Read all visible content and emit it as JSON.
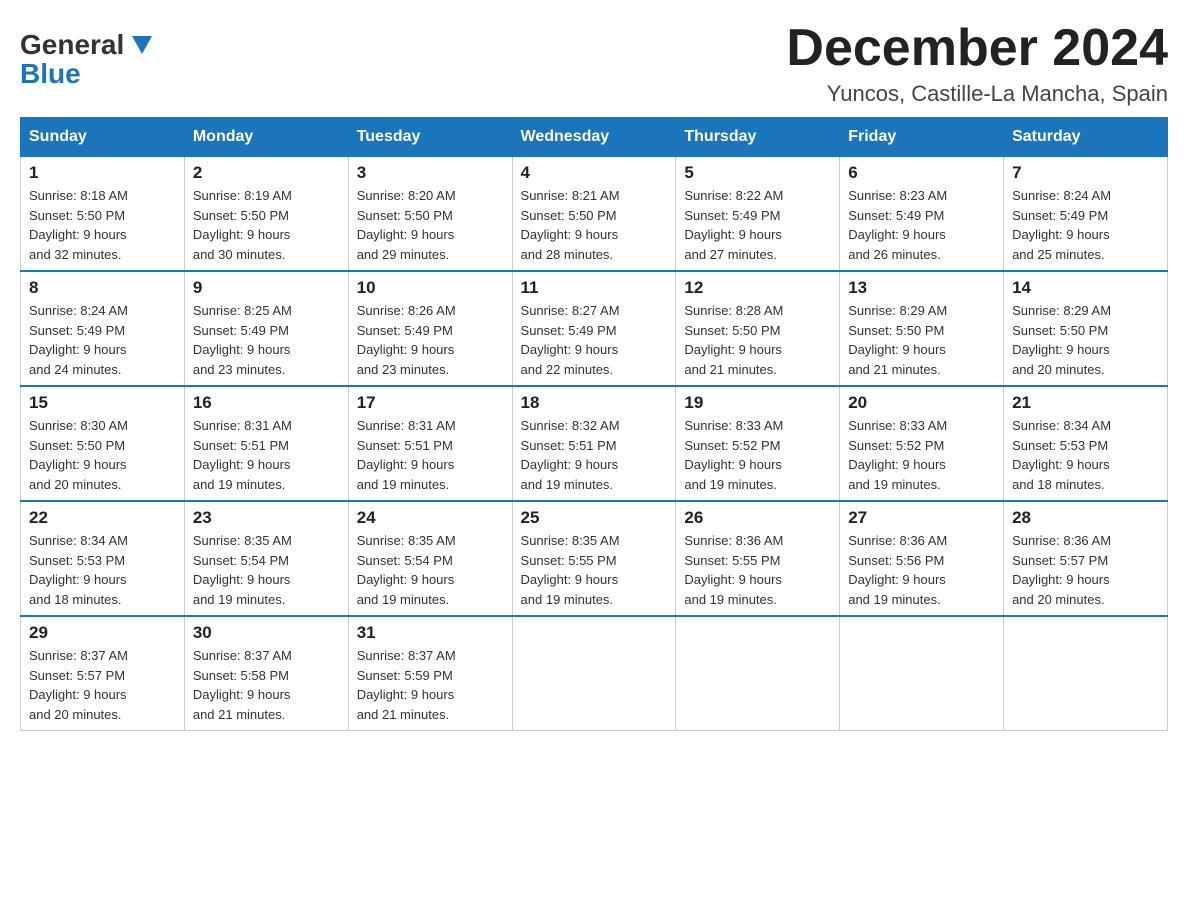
{
  "header": {
    "logo": {
      "general": "General",
      "blue": "Blue"
    },
    "title": "December 2024",
    "location": "Yuncos, Castille-La Mancha, Spain"
  },
  "calendar": {
    "days_of_week": [
      "Sunday",
      "Monday",
      "Tuesday",
      "Wednesday",
      "Thursday",
      "Friday",
      "Saturday"
    ],
    "weeks": [
      [
        {
          "day": "1",
          "sunrise": "Sunrise: 8:18 AM",
          "sunset": "Sunset: 5:50 PM",
          "daylight": "Daylight: 9 hours",
          "daylight2": "and 32 minutes."
        },
        {
          "day": "2",
          "sunrise": "Sunrise: 8:19 AM",
          "sunset": "Sunset: 5:50 PM",
          "daylight": "Daylight: 9 hours",
          "daylight2": "and 30 minutes."
        },
        {
          "day": "3",
          "sunrise": "Sunrise: 8:20 AM",
          "sunset": "Sunset: 5:50 PM",
          "daylight": "Daylight: 9 hours",
          "daylight2": "and 29 minutes."
        },
        {
          "day": "4",
          "sunrise": "Sunrise: 8:21 AM",
          "sunset": "Sunset: 5:50 PM",
          "daylight": "Daylight: 9 hours",
          "daylight2": "and 28 minutes."
        },
        {
          "day": "5",
          "sunrise": "Sunrise: 8:22 AM",
          "sunset": "Sunset: 5:49 PM",
          "daylight": "Daylight: 9 hours",
          "daylight2": "and 27 minutes."
        },
        {
          "day": "6",
          "sunrise": "Sunrise: 8:23 AM",
          "sunset": "Sunset: 5:49 PM",
          "daylight": "Daylight: 9 hours",
          "daylight2": "and 26 minutes."
        },
        {
          "day": "7",
          "sunrise": "Sunrise: 8:24 AM",
          "sunset": "Sunset: 5:49 PM",
          "daylight": "Daylight: 9 hours",
          "daylight2": "and 25 minutes."
        }
      ],
      [
        {
          "day": "8",
          "sunrise": "Sunrise: 8:24 AM",
          "sunset": "Sunset: 5:49 PM",
          "daylight": "Daylight: 9 hours",
          "daylight2": "and 24 minutes."
        },
        {
          "day": "9",
          "sunrise": "Sunrise: 8:25 AM",
          "sunset": "Sunset: 5:49 PM",
          "daylight": "Daylight: 9 hours",
          "daylight2": "and 23 minutes."
        },
        {
          "day": "10",
          "sunrise": "Sunrise: 8:26 AM",
          "sunset": "Sunset: 5:49 PM",
          "daylight": "Daylight: 9 hours",
          "daylight2": "and 23 minutes."
        },
        {
          "day": "11",
          "sunrise": "Sunrise: 8:27 AM",
          "sunset": "Sunset: 5:49 PM",
          "daylight": "Daylight: 9 hours",
          "daylight2": "and 22 minutes."
        },
        {
          "day": "12",
          "sunrise": "Sunrise: 8:28 AM",
          "sunset": "Sunset: 5:50 PM",
          "daylight": "Daylight: 9 hours",
          "daylight2": "and 21 minutes."
        },
        {
          "day": "13",
          "sunrise": "Sunrise: 8:29 AM",
          "sunset": "Sunset: 5:50 PM",
          "daylight": "Daylight: 9 hours",
          "daylight2": "and 21 minutes."
        },
        {
          "day": "14",
          "sunrise": "Sunrise: 8:29 AM",
          "sunset": "Sunset: 5:50 PM",
          "daylight": "Daylight: 9 hours",
          "daylight2": "and 20 minutes."
        }
      ],
      [
        {
          "day": "15",
          "sunrise": "Sunrise: 8:30 AM",
          "sunset": "Sunset: 5:50 PM",
          "daylight": "Daylight: 9 hours",
          "daylight2": "and 20 minutes."
        },
        {
          "day": "16",
          "sunrise": "Sunrise: 8:31 AM",
          "sunset": "Sunset: 5:51 PM",
          "daylight": "Daylight: 9 hours",
          "daylight2": "and 19 minutes."
        },
        {
          "day": "17",
          "sunrise": "Sunrise: 8:31 AM",
          "sunset": "Sunset: 5:51 PM",
          "daylight": "Daylight: 9 hours",
          "daylight2": "and 19 minutes."
        },
        {
          "day": "18",
          "sunrise": "Sunrise: 8:32 AM",
          "sunset": "Sunset: 5:51 PM",
          "daylight": "Daylight: 9 hours",
          "daylight2": "and 19 minutes."
        },
        {
          "day": "19",
          "sunrise": "Sunrise: 8:33 AM",
          "sunset": "Sunset: 5:52 PM",
          "daylight": "Daylight: 9 hours",
          "daylight2": "and 19 minutes."
        },
        {
          "day": "20",
          "sunrise": "Sunrise: 8:33 AM",
          "sunset": "Sunset: 5:52 PM",
          "daylight": "Daylight: 9 hours",
          "daylight2": "and 19 minutes."
        },
        {
          "day": "21",
          "sunrise": "Sunrise: 8:34 AM",
          "sunset": "Sunset: 5:53 PM",
          "daylight": "Daylight: 9 hours",
          "daylight2": "and 18 minutes."
        }
      ],
      [
        {
          "day": "22",
          "sunrise": "Sunrise: 8:34 AM",
          "sunset": "Sunset: 5:53 PM",
          "daylight": "Daylight: 9 hours",
          "daylight2": "and 18 minutes."
        },
        {
          "day": "23",
          "sunrise": "Sunrise: 8:35 AM",
          "sunset": "Sunset: 5:54 PM",
          "daylight": "Daylight: 9 hours",
          "daylight2": "and 19 minutes."
        },
        {
          "day": "24",
          "sunrise": "Sunrise: 8:35 AM",
          "sunset": "Sunset: 5:54 PM",
          "daylight": "Daylight: 9 hours",
          "daylight2": "and 19 minutes."
        },
        {
          "day": "25",
          "sunrise": "Sunrise: 8:35 AM",
          "sunset": "Sunset: 5:55 PM",
          "daylight": "Daylight: 9 hours",
          "daylight2": "and 19 minutes."
        },
        {
          "day": "26",
          "sunrise": "Sunrise: 8:36 AM",
          "sunset": "Sunset: 5:55 PM",
          "daylight": "Daylight: 9 hours",
          "daylight2": "and 19 minutes."
        },
        {
          "day": "27",
          "sunrise": "Sunrise: 8:36 AM",
          "sunset": "Sunset: 5:56 PM",
          "daylight": "Daylight: 9 hours",
          "daylight2": "and 19 minutes."
        },
        {
          "day": "28",
          "sunrise": "Sunrise: 8:36 AM",
          "sunset": "Sunset: 5:57 PM",
          "daylight": "Daylight: 9 hours",
          "daylight2": "and 20 minutes."
        }
      ],
      [
        {
          "day": "29",
          "sunrise": "Sunrise: 8:37 AM",
          "sunset": "Sunset: 5:57 PM",
          "daylight": "Daylight: 9 hours",
          "daylight2": "and 20 minutes."
        },
        {
          "day": "30",
          "sunrise": "Sunrise: 8:37 AM",
          "sunset": "Sunset: 5:58 PM",
          "daylight": "Daylight: 9 hours",
          "daylight2": "and 21 minutes."
        },
        {
          "day": "31",
          "sunrise": "Sunrise: 8:37 AM",
          "sunset": "Sunset: 5:59 PM",
          "daylight": "Daylight: 9 hours",
          "daylight2": "and 21 minutes."
        },
        null,
        null,
        null,
        null
      ]
    ]
  },
  "colors": {
    "header_bg": "#1a75bb",
    "header_text": "#ffffff",
    "border": "#cccccc"
  }
}
